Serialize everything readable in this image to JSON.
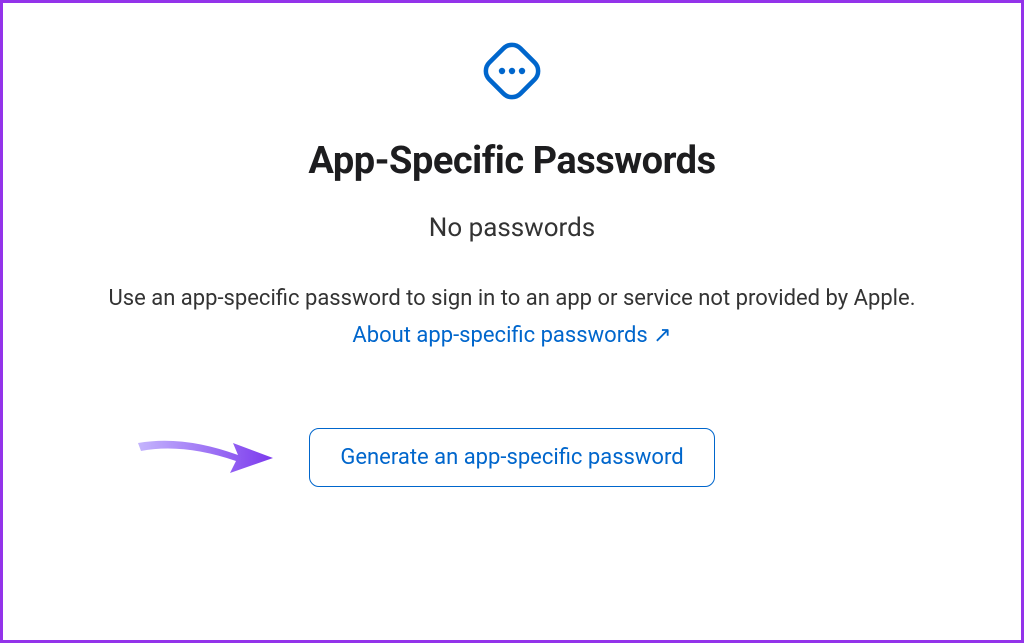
{
  "icon": "more-options-icon",
  "title": "App-Specific Passwords",
  "subtitle": "No passwords",
  "description": "Use an app-specific password to sign in to an app or service not provided by Apple.",
  "learn_more": "About app-specific passwords ↗",
  "generate_button": "Generate an app-specific password",
  "colors": {
    "accent_blue": "#0066cc",
    "annotation_purple": "#8b5cf6",
    "border_purple": "#9333ea"
  }
}
